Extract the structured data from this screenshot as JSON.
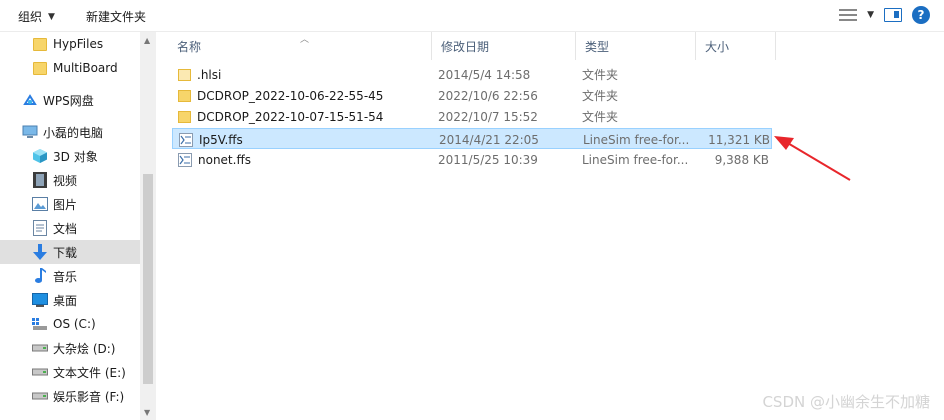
{
  "toolbar": {
    "organize_label": "组织",
    "new_folder_label": "新建文件夹"
  },
  "sidebar": {
    "items": [
      {
        "label": "HypFiles",
        "icon": "folder-icon"
      },
      {
        "label": "MultiBoard",
        "icon": "folder-icon"
      },
      {
        "label": "WPS网盘",
        "icon": "cloud-icon"
      },
      {
        "label": "小磊的电脑",
        "icon": "computer-icon"
      },
      {
        "label": "3D 对象",
        "icon": "cube-icon"
      },
      {
        "label": "视频",
        "icon": "film-icon"
      },
      {
        "label": "图片",
        "icon": "picture-icon"
      },
      {
        "label": "文档",
        "icon": "document-icon"
      },
      {
        "label": "下载",
        "icon": "download-arrow-icon"
      },
      {
        "label": "音乐",
        "icon": "music-note-icon"
      },
      {
        "label": "桌面",
        "icon": "desktop-icon"
      },
      {
        "label": "OS (C:)",
        "icon": "os-drive-icon"
      },
      {
        "label": "大杂烩 (D:)",
        "icon": "drive-icon"
      },
      {
        "label": "文本文件 (E:)",
        "icon": "drive-icon"
      },
      {
        "label": "娱乐影音 (F:)",
        "icon": "drive-icon"
      }
    ],
    "selected_label": "下载"
  },
  "columns": {
    "name": "名称",
    "date": "修改日期",
    "type": "类型",
    "size": "大小"
  },
  "files": [
    {
      "name": ".hlsi",
      "date": "2014/5/4 14:58",
      "type": "文件夹",
      "size": "",
      "icon": "folder-icon"
    },
    {
      "name": "DCDROP_2022-10-06-22-55-45",
      "date": "2022/10/6 22:56",
      "type": "文件夹",
      "size": "",
      "icon": "folder-icon"
    },
    {
      "name": "DCDROP_2022-10-07-15-51-54",
      "date": "2022/10/7 15:52",
      "type": "文件夹",
      "size": "",
      "icon": "folder-icon"
    },
    {
      "name": "Ip5V.ffs",
      "date": "2014/4/21 22:05",
      "type": "LineSim free-for...",
      "size": "11,321 KB",
      "icon": "linesim-file-icon"
    },
    {
      "name": "nonet.ffs",
      "date": "2011/5/25 10:39",
      "type": "LineSim free-for...",
      "size": "9,388 KB",
      "icon": "linesim-file-icon"
    }
  ],
  "selected_file": "Ip5V.ffs",
  "watermark": "CSDN @小幽余生不加糖",
  "colors": {
    "selection_fill": "#cce8ff",
    "selection_border": "#99d1ff",
    "annotation_arrow": "#e8262b",
    "accent": "#1b6ec2"
  }
}
